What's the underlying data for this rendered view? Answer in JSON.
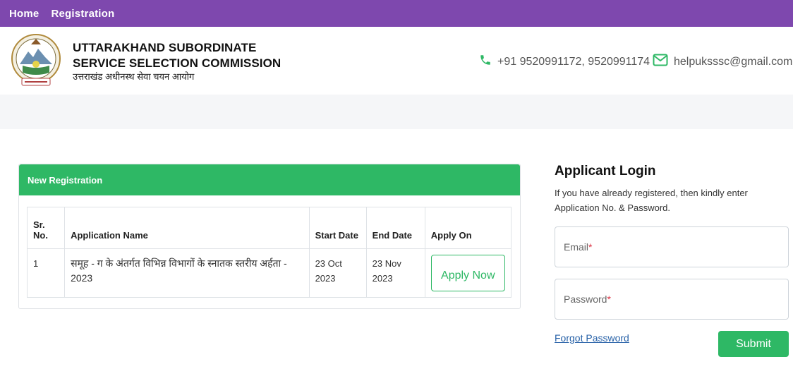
{
  "nav": {
    "items": [
      "Home",
      "Registration"
    ]
  },
  "header": {
    "title_line1": "UTTARAKHAND SUBORDINATE",
    "title_line2": "SERVICE SELECTION COMMISSION",
    "title_hindi": "उत्तराखंड अधीनस्थ सेवा चयन आयोग",
    "phone": "+91 9520991172, 9520991174",
    "email": "helpuksssc@gmail.com"
  },
  "registration": {
    "heading": "New Registration",
    "columns": [
      "Sr. No.",
      "Application Name",
      "Start Date",
      "End Date",
      "Apply On"
    ],
    "rows": [
      {
        "sr": "1",
        "name": "समूह - ग के अंतर्गत विभिन्न विभागों के स्नातक स्तरीय अर्हता - 2023",
        "start": "23 Oct 2023",
        "end": "23 Nov 2023",
        "action": "Apply Now"
      }
    ]
  },
  "login": {
    "heading": "Applicant Login",
    "description": "If you have already registered, then kindly enter Application No. & Password.",
    "email_label": "Email",
    "password_label": "Password",
    "required_mark": "*",
    "forgot": "Forgot Password",
    "submit": "Submit"
  },
  "colors": {
    "nav": "#7e48ae",
    "accent": "#2eb865",
    "link": "#2862a8"
  }
}
